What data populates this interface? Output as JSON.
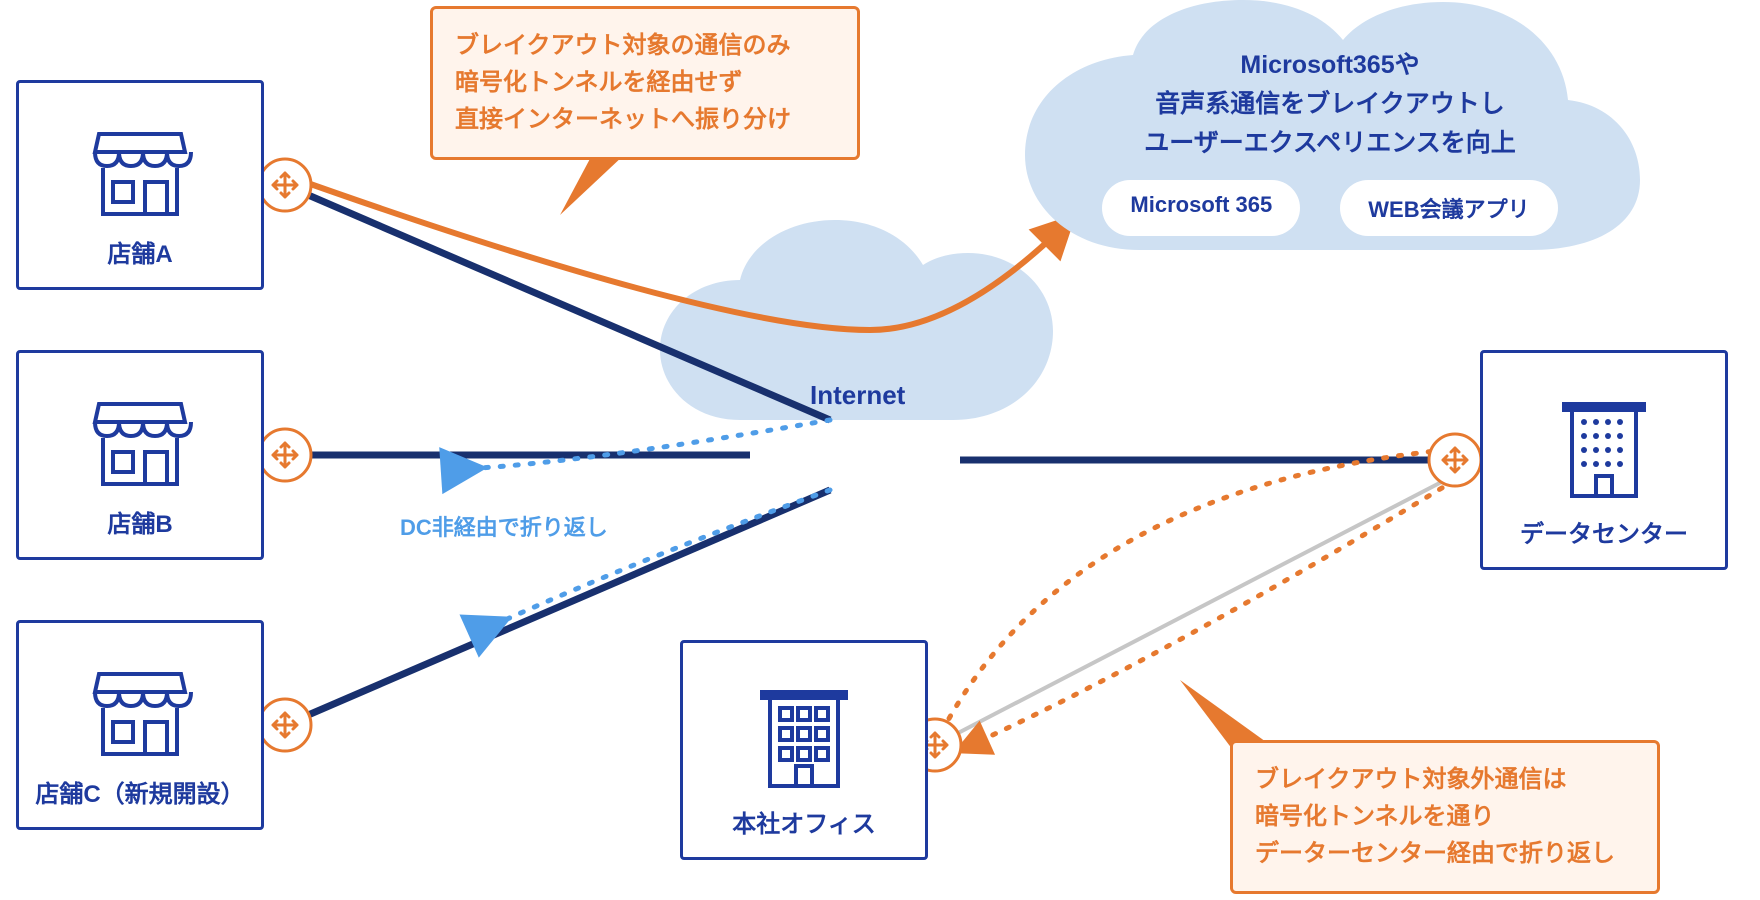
{
  "nodes": {
    "storeA": {
      "label": "店舗A"
    },
    "storeB": {
      "label": "店舗B"
    },
    "storeC": {
      "label": "店舗C（新規開設）"
    },
    "hq": {
      "label": "本社オフィス"
    },
    "dc": {
      "label": "データセンター"
    }
  },
  "internet": {
    "label": "Internet"
  },
  "cloud": {
    "headline_l1": "Microsoft365や",
    "headline_l2": "音声系通信をブレイクアウトし",
    "headline_l3": "ユーザーエクスペリエンスを向上",
    "pill1": "Microsoft 365",
    "pill2": "WEB会議アプリ"
  },
  "callouts": {
    "top": {
      "l1": "ブレイクアウト対象の通信のみ",
      "l2": "暗号化トンネルを経由せず",
      "l3": "直接インターネットへ振り分け"
    },
    "bottom": {
      "l1": "ブレイクアウト対象外通信は",
      "l2": "暗号化トンネルを通り",
      "l3": "データーセンター経由で折り返し"
    }
  },
  "labels": {
    "dc_loopback": "DC非経由で折り返し"
  },
  "diagram": {
    "description": "SD-WAN style network: three stores (A/B/C) on the left, a headquarters office bottom-centre and a data-centre on the right are all connected via dark-blue encrypted tunnel lines through an 'Internet' cloud in the middle. A separate orange breakout line goes from Store A up to a large cloud (Microsoft 365 / WEB会議アプリ) bypassing the tunnel. Dotted orange lines loop from the headquarters via the data-centre and back, illustrating non-breakout traffic hair-pinning through the DC. Dotted light-blue arrows between the two left stores show store-to-store traffic folding back without going to the DC.",
    "edges": [
      {
        "from": "storeA",
        "to": "internet",
        "style": "solid-navy",
        "note": "encrypted tunnel"
      },
      {
        "from": "storeB",
        "to": "internet",
        "style": "solid-navy",
        "note": "encrypted tunnel"
      },
      {
        "from": "storeC",
        "to": "internet",
        "style": "solid-navy",
        "note": "encrypted tunnel"
      },
      {
        "from": "internet",
        "to": "dc",
        "style": "solid-navy",
        "note": "encrypted tunnel"
      },
      {
        "from": "hq",
        "to": "dc",
        "style": "solid-grey",
        "note": "direct link"
      },
      {
        "from": "storeA",
        "to": "cloud",
        "style": "solid-orange-arrow",
        "note": "breakout direct to SaaS"
      },
      {
        "from": "hq",
        "to": "dc",
        "style": "dotted-orange-loop",
        "note": "non-breakout hairpins via DC"
      },
      {
        "from": "storeA",
        "to": "storeB",
        "style": "dotted-blue-arrow",
        "note": "DC非経由で折り返し"
      },
      {
        "from": "storeA",
        "to": "storeC",
        "style": "dotted-blue-arrow",
        "note": "DC非経由で折り返し"
      }
    ]
  }
}
